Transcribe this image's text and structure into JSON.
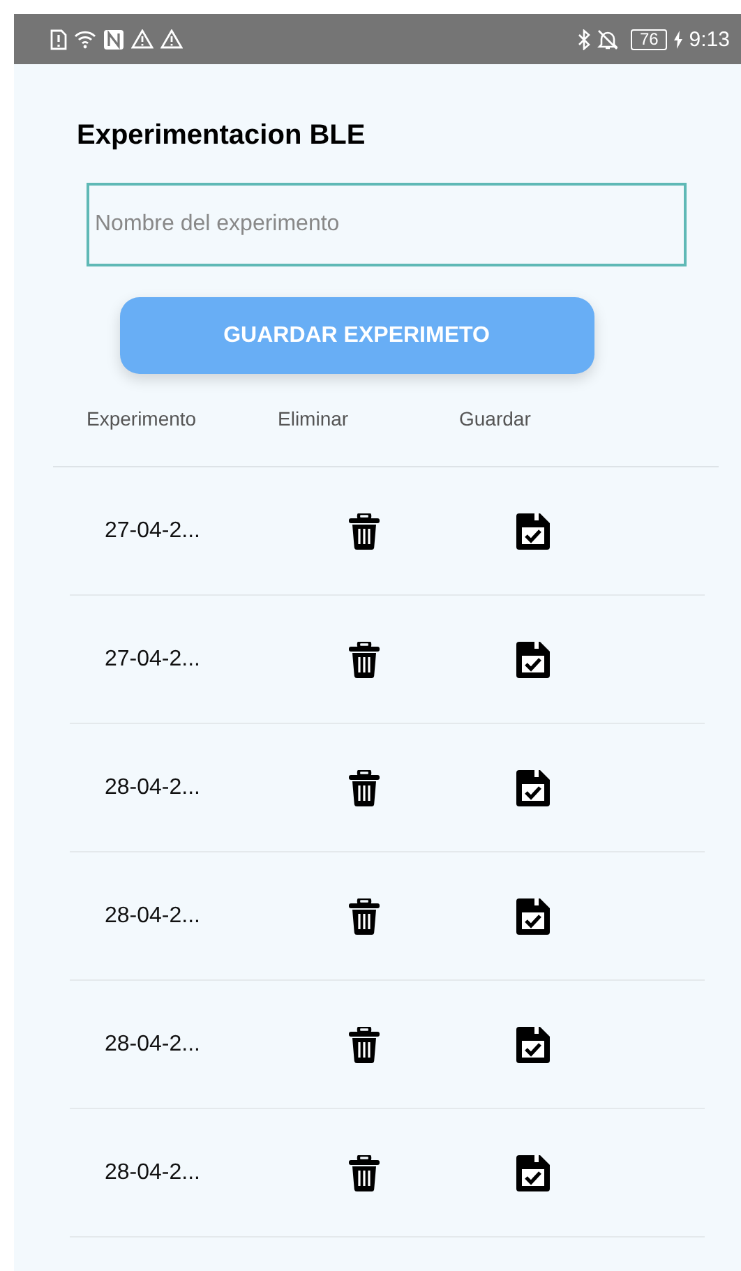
{
  "status_bar": {
    "battery": "76",
    "time": "9:13"
  },
  "title": "Experimentacion BLE",
  "name_field": {
    "placeholder": "Nombre del experimento"
  },
  "save_button": "GUARDAR EXPERIMETO",
  "columns": [
    "Experimento",
    "Eliminar",
    "Guardar"
  ],
  "rows": [
    {
      "name": "27-04-2..."
    },
    {
      "name": "27-04-2..."
    },
    {
      "name": "28-04-2..."
    },
    {
      "name": "28-04-2..."
    },
    {
      "name": "28-04-2..."
    },
    {
      "name": "28-04-2..."
    }
  ]
}
